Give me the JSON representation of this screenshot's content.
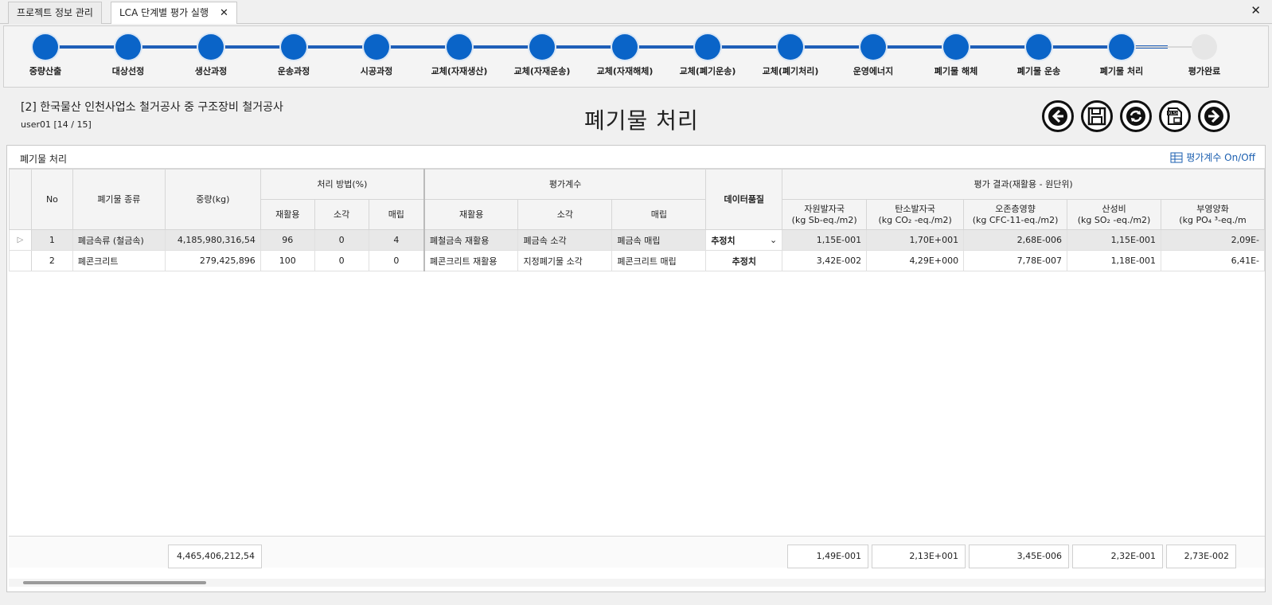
{
  "tabs": [
    {
      "label": "프로젝트 정보 관리",
      "active": false
    },
    {
      "label": "LCA 단계별 평가 실행",
      "active": true
    }
  ],
  "steps": [
    {
      "label": "중량산출",
      "done": true
    },
    {
      "label": "대상선정",
      "done": true
    },
    {
      "label": "생산과정",
      "done": true
    },
    {
      "label": "운송과정",
      "done": true
    },
    {
      "label": "시공과정",
      "done": true
    },
    {
      "label": "교체(자재생산)",
      "done": true
    },
    {
      "label": "교체(자재운송)",
      "done": true
    },
    {
      "label": "교체(자재해체)",
      "done": true
    },
    {
      "label": "교체(폐기운송)",
      "done": true
    },
    {
      "label": "교체(폐기처리)",
      "done": true
    },
    {
      "label": "운영에너지",
      "done": true
    },
    {
      "label": "폐기물 해체",
      "done": true
    },
    {
      "label": "폐기물 운송",
      "done": true
    },
    {
      "label": "폐기물 처리",
      "done": true
    },
    {
      "label": "평가완료",
      "done": false
    }
  ],
  "header": {
    "project_title": "[2] 한국물산 인천사업소 철거공사 중 구조장비 철거공사",
    "user_info": "user01   [14 / 15]",
    "page_title": "폐기물 처리"
  },
  "panel": {
    "title": "폐기물 처리",
    "toggle_label": "평가계수 On/Off"
  },
  "table": {
    "headers": {
      "no": "No",
      "waste_type": "폐기물 종류",
      "weight": "중량(kg)",
      "method_group": "처리 방법(%)",
      "recycle": "재활용",
      "incinerate": "소각",
      "landfill": "매립",
      "coef_group": "평가계수",
      "coef_recycle": "재활용",
      "coef_incinerate": "소각",
      "coef_landfill": "매립",
      "data_quality": "데이터품질",
      "result_group": "평가 결과(재활용 - 원단위)",
      "res1_name": "자원발자국",
      "res1_unit": "(kg Sb-eq./m2)",
      "res2_name": "탄소발자국",
      "res2_unit": "(kg CO₂ -eq./m2)",
      "res3_name": "오존층영향",
      "res3_unit": "(kg CFC-11-eq./m2)",
      "res4_name": "산성비",
      "res4_unit": "(kg SO₂ -eq./m2)",
      "res5_name": "부영양화",
      "res5_unit": "(kg PO₄ ³-eq./m"
    },
    "rows": [
      {
        "no": "1",
        "waste_type": "폐금속류 (철금속)",
        "weight": "4,185,980,316,54",
        "recycle": "96",
        "incinerate": "0",
        "landfill": "4",
        "coef_recycle": "폐철금속 재활용",
        "coef_incinerate": "폐금속 소각",
        "coef_landfill": "폐금속 매립",
        "data_quality": "추정치",
        "res1": "1,15E-001",
        "res2": "1,70E+001",
        "res3": "2,68E-006",
        "res4": "1,15E-001",
        "res5": "2,09E-"
      },
      {
        "no": "2",
        "waste_type": "폐콘크리트",
        "weight": "279,425,896",
        "recycle": "100",
        "incinerate": "0",
        "landfill": "0",
        "coef_recycle": "폐콘크리트 재활용",
        "coef_incinerate": "지정폐기물 소각",
        "coef_landfill": "폐콘크리트 매립",
        "data_quality": "추정치",
        "res1": "3,42E-002",
        "res2": "4,29E+000",
        "res3": "7,78E-007",
        "res4": "1,18E-001",
        "res5": "6,41E-"
      }
    ]
  },
  "summary": {
    "weight_total": "4,465,406,212,54",
    "res1_total": "1,49E-001",
    "res2_total": "2,13E+001",
    "res3_total": "3,45E-006",
    "res4_total": "2,32E-001",
    "res5_total": "2,73E-002"
  },
  "colors": {
    "accent": "#0a64c8",
    "pending": "#e6e6e6"
  }
}
